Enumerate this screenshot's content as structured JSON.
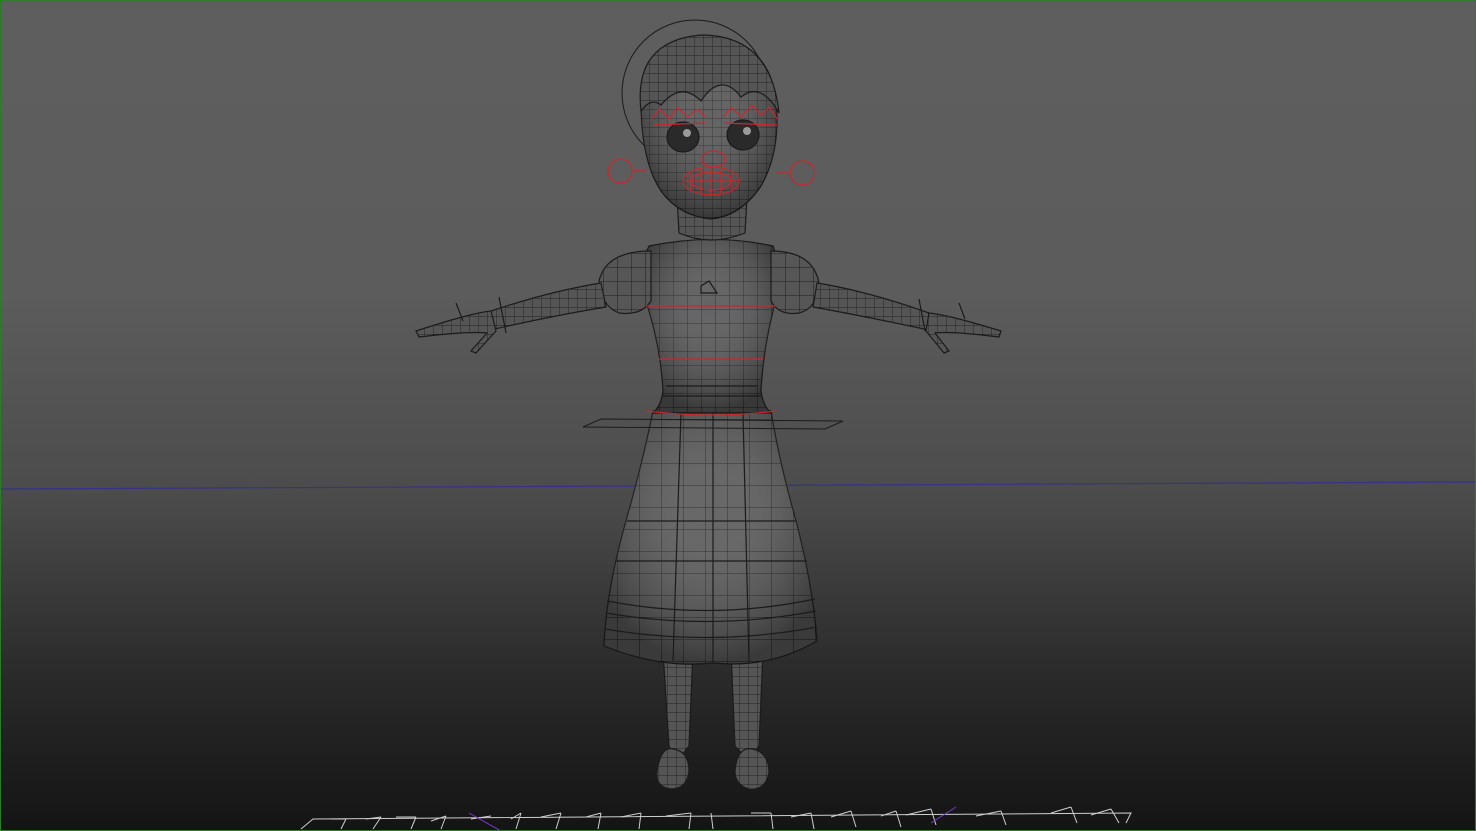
{
  "viewport": {
    "background_top": "#5e5e5e",
    "background_bottom": "#141414",
    "border_color": "#2f7a2f",
    "horizon_color": "#33338a"
  },
  "character": {
    "wire_color": "#1b1b1b",
    "body_fill": "#5a5a5a",
    "control_color": "#c8282f"
  },
  "grid": {
    "line_color": "#d0d0d0",
    "accent_color": "#7a3ad0"
  }
}
